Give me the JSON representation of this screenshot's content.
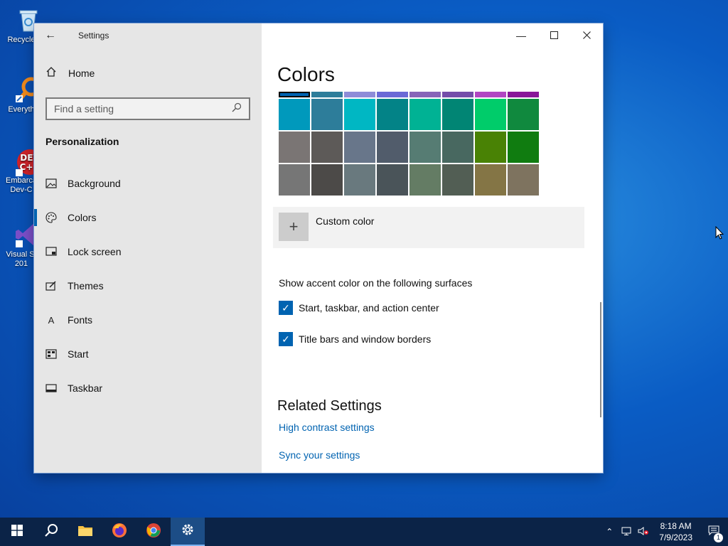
{
  "desktop": {
    "icons": [
      {
        "label": "Recycle",
        "icon": "recycle-bin-icon"
      },
      {
        "label": "Everyth",
        "icon": "everything-search-icon"
      },
      {
        "label": "Embarca Dev-C",
        "icon": "dev-cpp-icon"
      },
      {
        "label": "Visual St 201",
        "icon": "visual-studio-icon"
      }
    ]
  },
  "window": {
    "title": "Settings",
    "sidebar": {
      "home_label": "Home",
      "search_placeholder": "Find a setting",
      "section_title": "Personalization",
      "items": [
        {
          "label": "Background",
          "icon": "picture-icon"
        },
        {
          "label": "Colors",
          "icon": "palette-icon",
          "active": true
        },
        {
          "label": "Lock screen",
          "icon": "lock-screen-icon"
        },
        {
          "label": "Themes",
          "icon": "themes-icon"
        },
        {
          "label": "Fonts",
          "icon": "fonts-icon"
        },
        {
          "label": "Start",
          "icon": "start-icon"
        },
        {
          "label": "Taskbar",
          "icon": "taskbar-icon"
        }
      ]
    },
    "content": {
      "page_title": "Colors",
      "swatch_rows": [
        [
          "#0063b1",
          "#2d7d9a",
          "#8e8cd8",
          "#6b69d6",
          "#8764b8",
          "#744da9",
          "#b146c2",
          "#881798"
        ],
        [
          "#0099bc",
          "#2d7d9a",
          "#00b7c3",
          "#038387",
          "#00b294",
          "#018574",
          "#00cc6a",
          "#10893e"
        ],
        [
          "#7a7574",
          "#5d5a58",
          "#68768a",
          "#515c6b",
          "#567c73",
          "#486860",
          "#498205",
          "#107c10"
        ],
        [
          "#767676",
          "#4c4a48",
          "#69797e",
          "#4a5459",
          "#647c64",
          "#525e54",
          "#847545",
          "#7e735f"
        ]
      ],
      "custom_color_label": "Custom color",
      "surfaces_label": "Show accent color on the following surfaces",
      "checkbox_start": "Start, taskbar, and action center",
      "checkbox_title_bars": "Title bars and window borders",
      "related_title": "Related Settings",
      "link_high_contrast": "High contrast settings",
      "link_sync": "Sync your settings"
    }
  },
  "taskbar": {
    "time": "8:18 AM",
    "date": "7/9/2023",
    "notification_count": "1"
  }
}
